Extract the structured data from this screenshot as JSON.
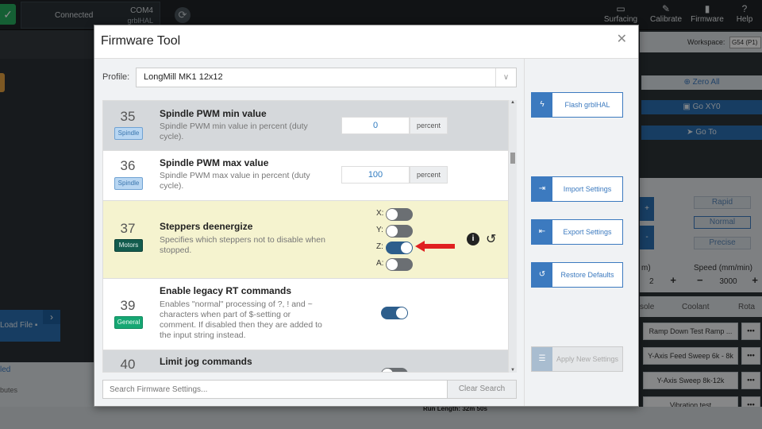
{
  "topbar": {
    "connection_status": "Connected",
    "port": "COM4",
    "firmware": "grblHAL",
    "nav": [
      {
        "label": "Surfacing",
        "icon": "surfacing-icon"
      },
      {
        "label": "Calibrate",
        "icon": "ruler-icon"
      },
      {
        "label": "Firmware",
        "icon": "chip-icon"
      },
      {
        "label": "Help",
        "icon": "question-icon"
      }
    ]
  },
  "background": {
    "workspace_label": "Workspace:",
    "workspace_value": "G54 (P1)",
    "zero_all": "Zero All",
    "go_xy0": "Go XY0",
    "go_to": "Go  To",
    "speeds": [
      "Rapid",
      "Normal",
      "Precise"
    ],
    "speed_label": "Speed (mm/min)",
    "m_label": "m)",
    "step_value": "2",
    "speed_value": "3000",
    "tabs": [
      "sole",
      "Coolant",
      "Rota"
    ],
    "macros": [
      "Ramp Down Test Ramp ...",
      "Y-Axis Feed Sweep 6k - 8k",
      "Y-Axis Sweep 8k-12k",
      "Vibration test"
    ],
    "load_file": "Load File",
    "left_label": "led",
    "left_label2": "butes",
    "run_length": "Run Length: 32m 50s"
  },
  "modal": {
    "title": "Firmware Tool",
    "profile_label": "Profile:",
    "profile_value": "LongMill MK1 12x12",
    "settings": [
      {
        "num": "35",
        "category": "Spindle",
        "title": "Spindle PWM min value",
        "desc": "Spindle PWM min value in percent (duty cycle).",
        "value": "0",
        "unit": "percent"
      },
      {
        "num": "36",
        "category": "Spindle",
        "title": "Spindle PWM max value",
        "desc": "Spindle PWM max value in percent (duty cycle).",
        "value": "100",
        "unit": "percent"
      },
      {
        "num": "37",
        "category": "Motors",
        "title": "Steppers deenergize",
        "desc": "Specifies which steppers not to disable when stopped.",
        "axes": [
          {
            "label": "X:",
            "on": false
          },
          {
            "label": "Y:",
            "on": false
          },
          {
            "label": "Z:",
            "on": true
          },
          {
            "label": "A:",
            "on": false
          }
        ]
      },
      {
        "num": "39",
        "category": "General",
        "title": "Enable legacy RT commands",
        "desc": "Enables \"normal\" processing of ?, ! and ~ characters when part of $-setting or comment. If disabled then they are added to the input string instead.",
        "on": true
      },
      {
        "num": "40",
        "category": "General",
        "title": "Limit jog commands",
        "desc": "",
        "on": false
      }
    ],
    "search_placeholder": "Search Firmware Settings...",
    "clear_search": "Clear Search",
    "actions": {
      "flash": "Flash grblHAL",
      "import": "Import Settings",
      "export": "Export Settings",
      "restore": "Restore Defaults",
      "apply": "Apply New Settings"
    }
  },
  "colors": {
    "accent": "#3c7abf",
    "highlight_row": "#f5f3cf",
    "connected": "#27ae60",
    "arrow": "#e02020"
  }
}
